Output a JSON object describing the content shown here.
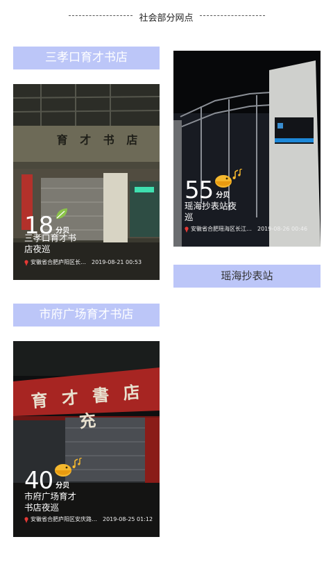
{
  "section": {
    "title": "社会部分网点"
  },
  "cards": [
    {
      "label": "三孝口育才书店",
      "score": "18",
      "score_unit": "分贝",
      "caption_line1": "三孝口育才书",
      "caption_line2": "店夜巡",
      "location": "安徽省合肥庐阳区长…",
      "timestamp": "2019-08-21 00:53",
      "badge_icon": "leaf-icon",
      "sign_text": "育 才 书 店"
    },
    {
      "label": "瑶海抄表站",
      "score": "55",
      "score_unit": "分贝",
      "caption_line1": "瑶海抄表站夜",
      "caption_line2": "巡",
      "location": "安徽省合肥瑶海区长江…",
      "timestamp": "2019-08-26 00:46",
      "badge_icon": "bird-music-icon"
    },
    {
      "label": "市府广场育才书店",
      "score": "40",
      "score_unit": "分贝",
      "caption_line1": "市府广场育才",
      "caption_line2": "书店夜巡",
      "location": "安徽省合肥庐阳区安庆路…",
      "timestamp": "2019-08-25 01:12",
      "badge_icon": "bird-music-icon",
      "sign_text": "育 才 書 店 充"
    }
  ],
  "colors": {
    "label_bg": "#bcc6f8",
    "accent_leaf": "#8bc34a",
    "accent_bird": "#f5b82e",
    "pin": "#e53935"
  }
}
